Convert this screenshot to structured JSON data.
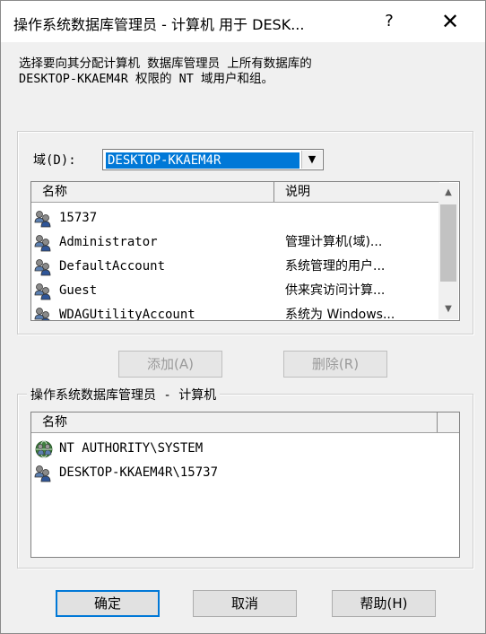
{
  "window": {
    "title": "操作系统数据库管理员 - 计算机 用于 DESK...",
    "help_glyph": "?",
    "close_glyph": "✕"
  },
  "description": "选择要向其分配计算机 数据库管理员 上所有数据库的\nDESKTOP-KKAEM4R 权限的 NT 域用户和组。",
  "domain": {
    "label": "域(D):",
    "value": "DESKTOP-KKAEM4R"
  },
  "available": {
    "columns": [
      "名称",
      "说明"
    ],
    "rows": [
      {
        "name": "15737",
        "desc": "",
        "icon": "user-icon"
      },
      {
        "name": "Administrator",
        "desc": "管理计算机(域)...",
        "icon": "user-icon"
      },
      {
        "name": "DefaultAccount",
        "desc": "系统管理的用户...",
        "icon": "user-icon"
      },
      {
        "name": "Guest",
        "desc": "供来宾访问计算...",
        "icon": "user-icon"
      },
      {
        "name": "WDAGUtilityAccount",
        "desc": "系统为 Windows...",
        "icon": "user-icon"
      }
    ]
  },
  "buttons": {
    "add": "添加(A)",
    "remove": "删除(R)",
    "ok": "确定",
    "cancel": "取消",
    "help": "帮助(H)"
  },
  "assigned": {
    "group_title": "操作系统数据库管理员 - 计算机",
    "columns": [
      "名称"
    ],
    "rows": [
      {
        "name": "NT AUTHORITY\\SYSTEM",
        "icon": "system-group-icon"
      },
      {
        "name": "DESKTOP-KKAEM4R\\15737",
        "icon": "user-icon"
      }
    ]
  },
  "colors": {
    "selection": "#0078d7",
    "accent": "#0078d7"
  }
}
